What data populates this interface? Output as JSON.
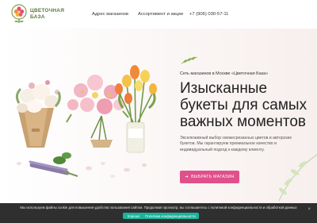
{
  "brand": {
    "line1": "ЦВЕТОЧНАЯ",
    "line2": "БАЗА"
  },
  "nav": {
    "addresses": "Адрес магазинов",
    "assortment": "Ассортимент и акции",
    "phone": "+7 (906) 030-57-11"
  },
  "hero": {
    "subtitle": "Сеть магазинов в Москве «Цветочная База»",
    "title": "Изысканные букеты для самых важных моментов",
    "description": "Эксклюзивный выбор свежесрезанных цветов и авторских букетов. Мы гарантируем премиальное качество и индивидуальный подход к каждому клиенту.",
    "cta": "ВЫБРАТЬ МАГАЗИН"
  },
  "cookie": {
    "text": "Мы используем файлы cookie для повышения удобства пользования сайтом. Продолжая просмотр, вы соглашаетесь с политикой конфиденциальности и обработкой данных",
    "accept": "Хорошо",
    "policy": "Политика конфиденциальности",
    "close": "×"
  },
  "colors": {
    "accent": "#e0508a",
    "brand_green": "#5a7a3a",
    "cookie_bg": "#2f2f2f",
    "cookie_btn": "#1bb39a"
  }
}
